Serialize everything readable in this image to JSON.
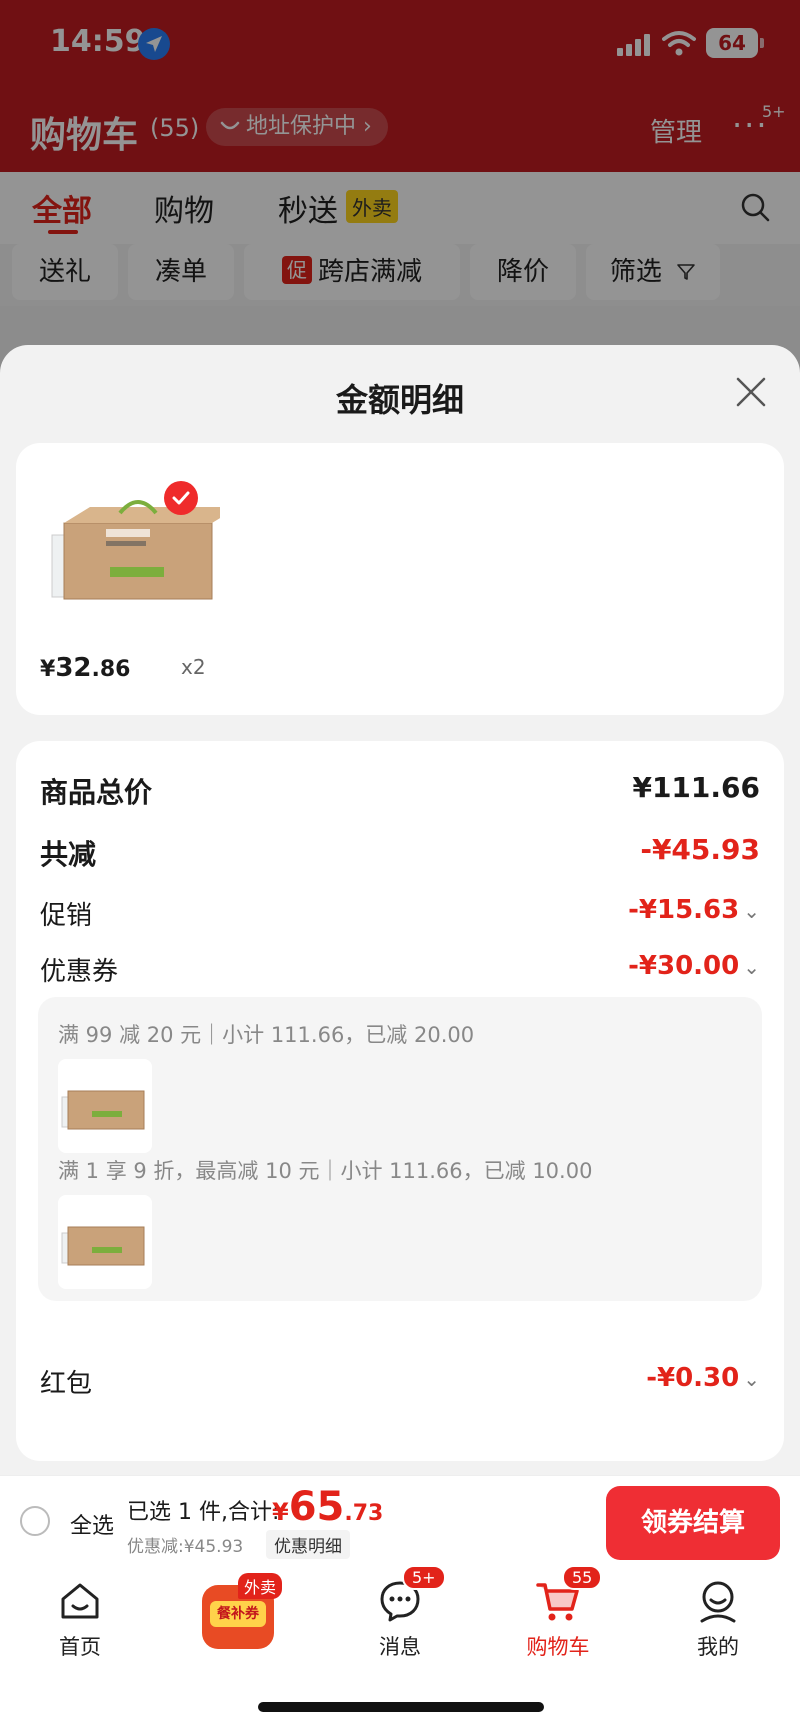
{
  "status_bar": {
    "time": "14:59",
    "battery": "64"
  },
  "header": {
    "title": "购物车",
    "count": "(55)",
    "address_pill": "地址保护中 ›",
    "manage": "管理",
    "more_badge": "5+"
  },
  "tabs": [
    {
      "label": "全部",
      "active": true
    },
    {
      "label": "购物"
    },
    {
      "label": "秒送"
    }
  ],
  "waimai_tag": "外卖",
  "filters": {
    "gift": "送礼",
    "bundle": "凑单",
    "promo_badge": "促",
    "promo": "跨店满减",
    "price_drop": "降价",
    "filter": "筛选"
  },
  "sheet": {
    "title": "金额明细",
    "item": {
      "price_symbol": "¥",
      "price_int": "32",
      "price_dec": ".86",
      "qty": "x2"
    },
    "rows": {
      "goods_total_label": "商品总价",
      "goods_total_value": "¥111.66",
      "total_reduce_label": "共减",
      "total_reduce_value": "-¥45.93",
      "promo_label": "促销",
      "promo_value": "-¥15.63",
      "coupon_label": "优惠券",
      "coupon_value": "-¥30.00",
      "redpacket_label": "红包",
      "redpacket_value": "-¥0.30"
    },
    "coupon_details": [
      "满 99 减 20 元｜小计 111.66，已减 20.00",
      "满 1 享 9 折，最高减 10 元｜小计 111.66，已减 10.00"
    ]
  },
  "bottom_bar": {
    "select_all": "全选",
    "summary": "已选 1 件,合计:",
    "total_symbol": "¥",
    "total_int": "65",
    "total_dec": ".73",
    "discount_note": "优惠减:¥45.93",
    "detail_chip": "优惠明细",
    "checkout": "领券结算"
  },
  "nav": {
    "home": "首页",
    "coupon_tag": "外卖",
    "coupon_text": "餐补券",
    "messages": "消息",
    "messages_badge": "5+",
    "cart": "购物车",
    "cart_badge": "55",
    "me": "我的"
  },
  "colors": {
    "brand_red": "#e2231a",
    "header_red": "#c21d22",
    "checkout_red": "#ef2e34"
  }
}
